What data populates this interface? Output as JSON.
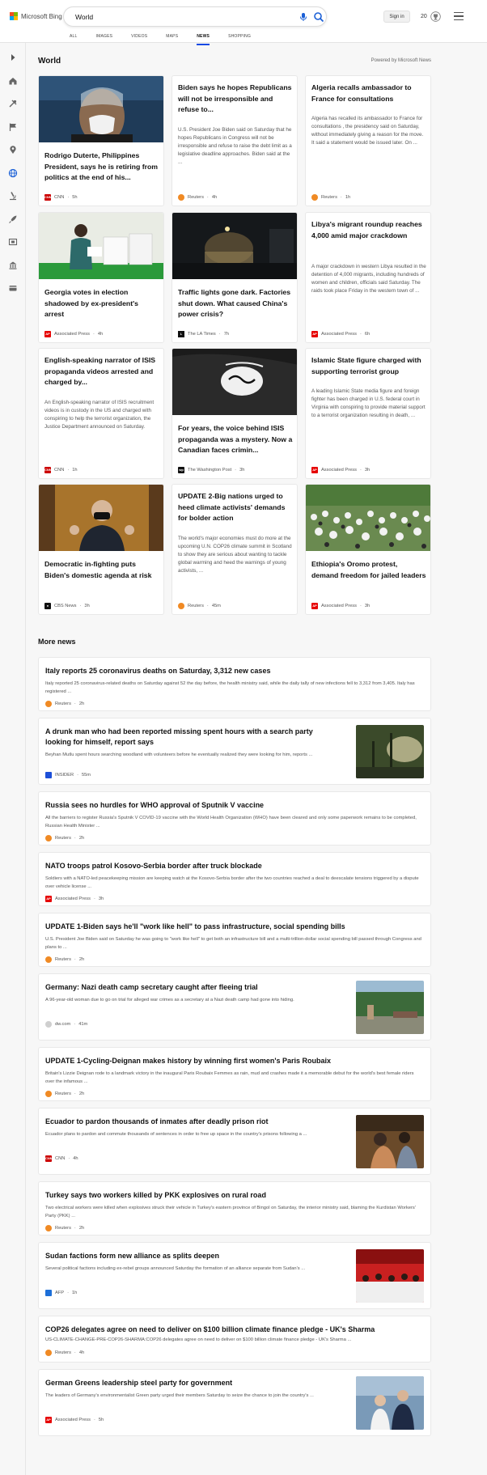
{
  "brand": {
    "name": "Microsoft Bing"
  },
  "search": {
    "value": "World"
  },
  "header": {
    "sign_in": "Sign in",
    "rewards_count": "20"
  },
  "tabs": [
    {
      "label": "ALL"
    },
    {
      "label": "IMAGES"
    },
    {
      "label": "VIDEOS"
    },
    {
      "label": "MAPS"
    },
    {
      "label": "NEWS",
      "active": true
    },
    {
      "label": "SHOPPING"
    }
  ],
  "sidebar": {
    "icons": [
      "chevron-right-icon",
      "home-icon",
      "tools-icon",
      "flag-icon",
      "map-pin-icon",
      "globe-icon",
      "microscope-icon",
      "rocket-icon",
      "film-icon",
      "bank-icon",
      "card-icon"
    ]
  },
  "world": {
    "title": "World",
    "powered_by": "Powered by Microsoft News",
    "cards": [
      {
        "title": "Rodrigo Duterte, Philippines President, says he is retiring from politics at the end of his...",
        "desc": "",
        "source": "CNN",
        "time": "5h",
        "source_color": "#cc0000"
      },
      {
        "title": "Biden says he hopes Republicans will not be irresponsible and refuse to...",
        "desc": "U.S. President Joe Biden said on Saturday that he hopes Republicans in Congress will not be irresponsible and refuse to raise the debt limit as a legislative deadline approaches. Biden said at the ...",
        "source": "Reuters",
        "time": "4h",
        "source_color": "#f08a24"
      },
      {
        "title": "Algeria recalls ambassador to France for consultations",
        "desc": "Algeria has recalled its ambassador to France for consultations , the presidency said on Saturday, without immediately giving a reason for the move. It said a statement would be issued later. On ...",
        "source": "Reuters",
        "time": "1h",
        "source_color": "#f08a24"
      },
      {
        "title": "Georgia votes in election shadowed by ex-president's arrest",
        "desc": "",
        "source": "Associated Press",
        "time": "4h",
        "source_color": "#e60000"
      },
      {
        "title": "Traffic lights gone dark. Factories shut down. What caused China's power crisis?",
        "desc": "",
        "source": "The LA Times",
        "time": "7h",
        "source_color": "#111111"
      },
      {
        "title": "Libya's migrant roundup reaches 4,000 amid major crackdown",
        "desc": "A major crackdown in western Libya resulted in the detention of 4,000 migrants, including hundreds of women and children, officials said Saturday. The raids took place Friday in the western town of ...",
        "source": "Associated Press",
        "time": "6h",
        "source_color": "#e60000"
      },
      {
        "title": "English-speaking narrator of ISIS propaganda videos arrested and charged by...",
        "desc": "An English-speaking narrator of ISIS recruitment videos is in custody in the US and charged with conspiring to help the terrorist organization, the Justice Department announced on Saturday.",
        "source": "CNN",
        "time": "1h",
        "source_color": "#cc0000"
      },
      {
        "title": "For years, the voice behind ISIS propaganda was a mystery. Now a Canadian faces crimin...",
        "desc": "",
        "source": "The Washington Post",
        "time": "3h",
        "source_color": "#111111"
      },
      {
        "title": "Islamic State figure charged with supporting terrorist group",
        "desc": "A leading Islamic State media figure and foreign fighter has been charged in U.S. federal court in Virginia with conspiring to provide material support to a terrorist organization resulting in death, ...",
        "source": "Associated Press",
        "time": "3h",
        "source_color": "#e60000"
      },
      {
        "title": "Democratic in-fighting puts Biden's domestic agenda at risk",
        "desc": "",
        "source": "CBS News",
        "time": "3h",
        "source_color": "#111111"
      },
      {
        "title": "UPDATE 2-Big nations urged to heed climate activists' demands for bolder action",
        "desc": "The world's major economies must do more at the upcoming U.N. COP26 climate summit in Scotland to show they are serious about wanting to tackle global warming and heed the warnings of young activists, ...",
        "source": "Reuters",
        "time": "45m",
        "source_color": "#f08a24"
      },
      {
        "title": "Ethiopia's Oromo protest, demand freedom for jailed leaders",
        "desc": "",
        "source": "Associated Press",
        "time": "3h",
        "source_color": "#e60000"
      }
    ]
  },
  "more": {
    "title": "More news",
    "items": [
      {
        "title": "Italy reports 25 coronavirus deaths on Saturday, 3,312 new cases",
        "desc": "Italy reported 25 coronavirus-related deaths on Saturday against 52 the day before, the health ministry said, while the daily tally of new infections fell to 3,312 from 3,405. Italy has registered ...",
        "source": "Reuters",
        "time": "2h",
        "source_color": "#f08a24"
      },
      {
        "title": "A drunk man who had been reported missing spent hours with a search party looking for himself, report says",
        "desc": "Beyhan Mutlu spent hours searching woodland with volunteers before he eventually realized they were looking for him, reports ...",
        "source": "INSIDER",
        "time": "55m",
        "source_color": "#1d4fd8"
      },
      {
        "title": "Russia sees no hurdles for WHO approval of Sputnik V vaccine",
        "desc": "All the barriers to register Russia's Sputnik V COVID-19 vaccine with the World Health Organization (WHO) have been cleared and only some paperwork remains to be completed, Russian Health Minister ...",
        "source": "Reuters",
        "time": "2h",
        "source_color": "#f08a24"
      },
      {
        "title": "NATO troops patrol Kosovo-Serbia border after truck blockade",
        "desc": "Soldiers with a NATO-led peacekeeping mission are keeping watch at the Kosovo-Serbia border after the two countries reached a deal to deescalate tensions triggered by a dispute over vehicle license ...",
        "source": "Associated Press",
        "time": "3h",
        "source_color": "#e60000"
      },
      {
        "title": "UPDATE 1-Biden says he'll \"work like hell\" to pass infrastructure, social spending bills",
        "desc": "U.S. President Joe Biden said on Saturday he was going to \"work like hell\" to get both an infrastructure bill and a multi-trillion-dollar social spending bill passed through Congress and plans to ...",
        "source": "Reuters",
        "time": "2h",
        "source_color": "#f08a24"
      },
      {
        "title": "Germany: Nazi death camp secretary caught after fleeing trial",
        "desc": "A 96-year-old woman due to go on trial for alleged war crimes as a secretary at a Nazi death camp had gone into hiding.",
        "source": "dw.com",
        "time": "41m",
        "source_color": "#bbbbbb"
      },
      {
        "title": "UPDATE 1-Cycling-Deignan makes history by winning first women's Paris Roubaix",
        "desc": "Britain's Lizzie Deignan rode to a landmark victory in the inaugural Paris Roubaix Femmes as rain, mud and crashes made it a memorable debut for the world's best female riders over the infamous ...",
        "source": "Reuters",
        "time": "2h",
        "source_color": "#f08a24"
      },
      {
        "title": "Ecuador to pardon thousands of inmates after deadly prison riot",
        "desc": "Ecuador plans to pardon and commute thousands of sentences in order to free up space in the country's prisons following a ...",
        "source": "CNN",
        "time": "4h",
        "source_color": "#cc0000"
      },
      {
        "title": "Turkey says two workers killed by PKK explosives on rural road",
        "desc": "Two electrical workers were killed when explosives struck their vehicle in Turkey's eastern province of Bingol on Saturday, the interior ministry said, blaming the Kurdistan Workers' Party (PKK) ...",
        "source": "Reuters",
        "time": "2h",
        "source_color": "#f08a24"
      },
      {
        "title": "Sudan factions form new alliance as splits deepen",
        "desc": "Several political factions including ex-rebel groups announced Saturday the formation of an alliance separate from Sudan's ...",
        "source": "AFP",
        "time": "1h",
        "source_color": "#1d6fd8"
      },
      {
        "title": "COP26 delegates agree on need to deliver on $100 billion climate finance pledge - UK's Sharma",
        "desc": "US-CLIMATE-CHANGE-PRE-COP26-SHARMA:COP26 delegates agree on need to deliver on $100 billion climate finance pledge - UK's Sharma ...",
        "source": "Reuters",
        "time": "4h",
        "source_color": "#f08a24"
      },
      {
        "title": "German Greens leadership steel party for government",
        "desc": "The leaders of Germany's environmentalist Green party urged their members Saturday to seize the chance to join the country's ...",
        "source": "Associated Press",
        "time": "5h",
        "source_color": "#e60000"
      }
    ]
  }
}
